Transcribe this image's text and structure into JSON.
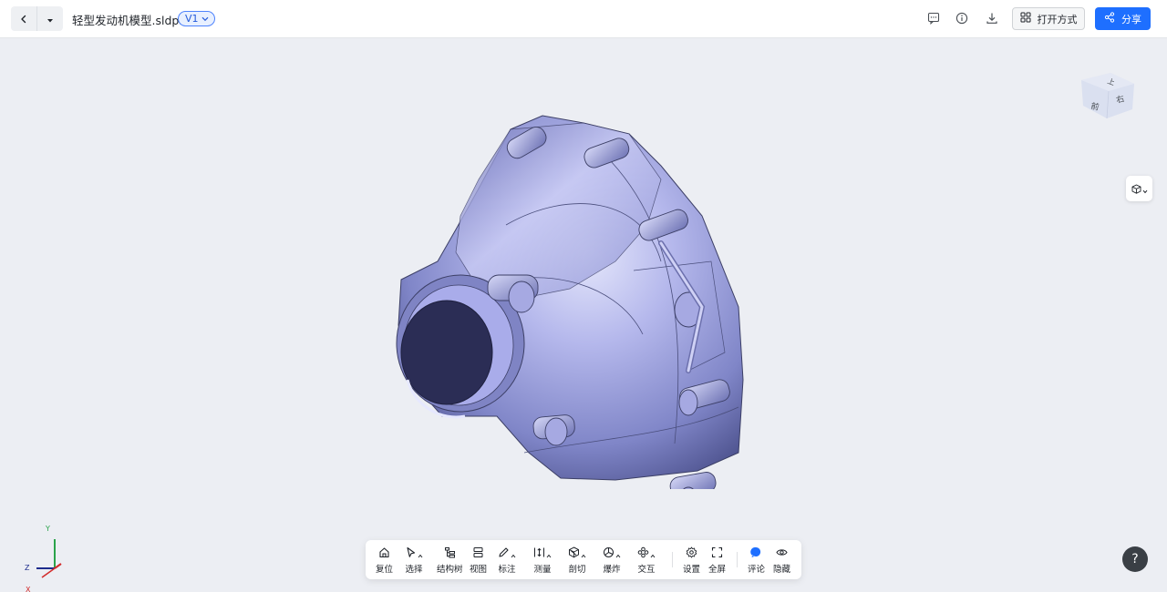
{
  "header": {
    "title": "轻型发动机模型.sldprt",
    "version": "V1",
    "open_with_label": "打开方式",
    "share_label": "分享",
    "icons": [
      "back-icon",
      "caret-down-icon",
      "comment-icon",
      "info-icon",
      "download-icon",
      "grid-icon",
      "share-icon"
    ]
  },
  "view_cube": {
    "front": "前",
    "right": "右",
    "top": "上"
  },
  "axes": {
    "y": "Y",
    "z": "Z",
    "x": "X"
  },
  "toolbar": {
    "reset": "复位",
    "select": "选择",
    "tree": "结构树",
    "view": "视图",
    "annotate": "标注",
    "measure": "测量",
    "section": "剖切",
    "explode": "爆炸",
    "interact": "交互",
    "settings": "设置",
    "fullscreen": "全屏",
    "comment": "评论",
    "hide": "隐藏"
  },
  "help": "?",
  "colors": {
    "primary": "#1e6fff",
    "model": "#8f94d6",
    "background": "#eceef3"
  }
}
